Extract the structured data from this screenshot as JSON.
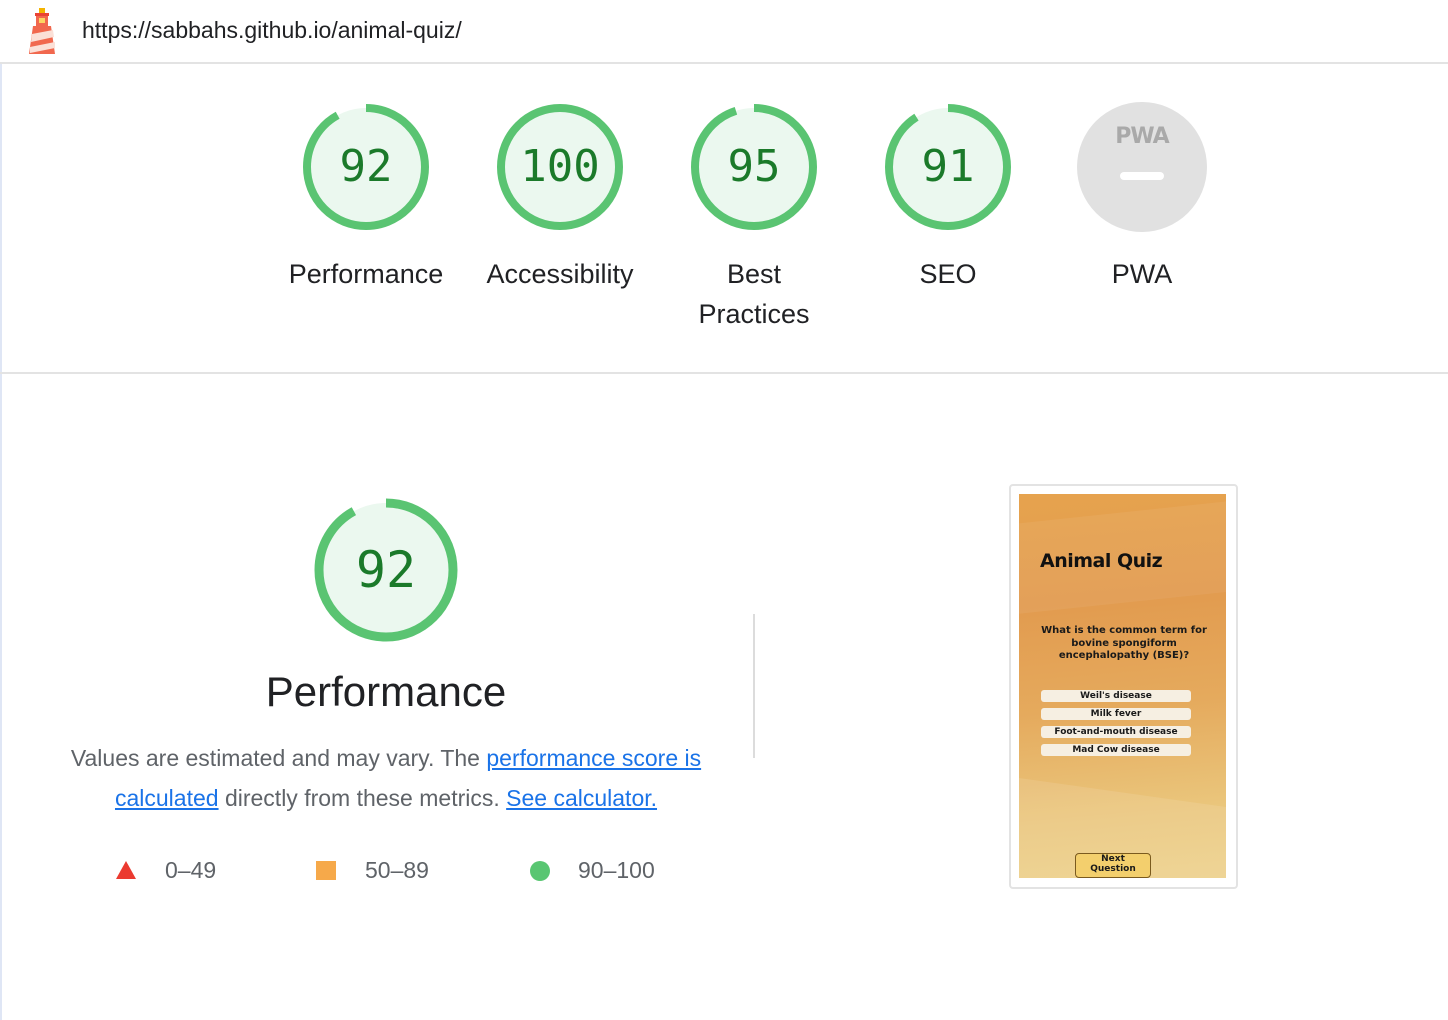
{
  "url_bar": {
    "url": "https://sabbahs.github.io/animal-quiz/"
  },
  "colors": {
    "pass": "#0cce6b",
    "pass_ring": "#5ac472",
    "average": "#f6a94a",
    "fail": "#eb3a30",
    "link": "#1a73e8"
  },
  "categories": [
    {
      "label": "Performance",
      "score": "92"
    },
    {
      "label": "Accessibility",
      "score": "100"
    },
    {
      "label": "Best Practices",
      "score": "95"
    },
    {
      "label": "SEO",
      "score": "91"
    },
    {
      "label": "PWA",
      "badge": "PWA"
    }
  ],
  "performance": {
    "score": "92",
    "title": "Performance",
    "desc_prefix": "Values are estimated and may vary. The ",
    "link_score": "performance score is calculated",
    "desc_middle": " directly from these metrics. ",
    "link_calculator": "See calculator.",
    "legend": [
      {
        "shape": "triangle",
        "range": "0–49"
      },
      {
        "shape": "square",
        "range": "50–89"
      },
      {
        "shape": "circle",
        "range": "90–100"
      }
    ]
  },
  "screenshot": {
    "title": "Animal Quiz",
    "question": "What is the common term for bovine spongiform encephalopathy (BSE)?",
    "answers": [
      "Weil's disease",
      "Milk fever",
      "Foot-and-mouth disease",
      "Mad Cow disease"
    ],
    "next_line1": "Next",
    "next_line2": "Question"
  }
}
